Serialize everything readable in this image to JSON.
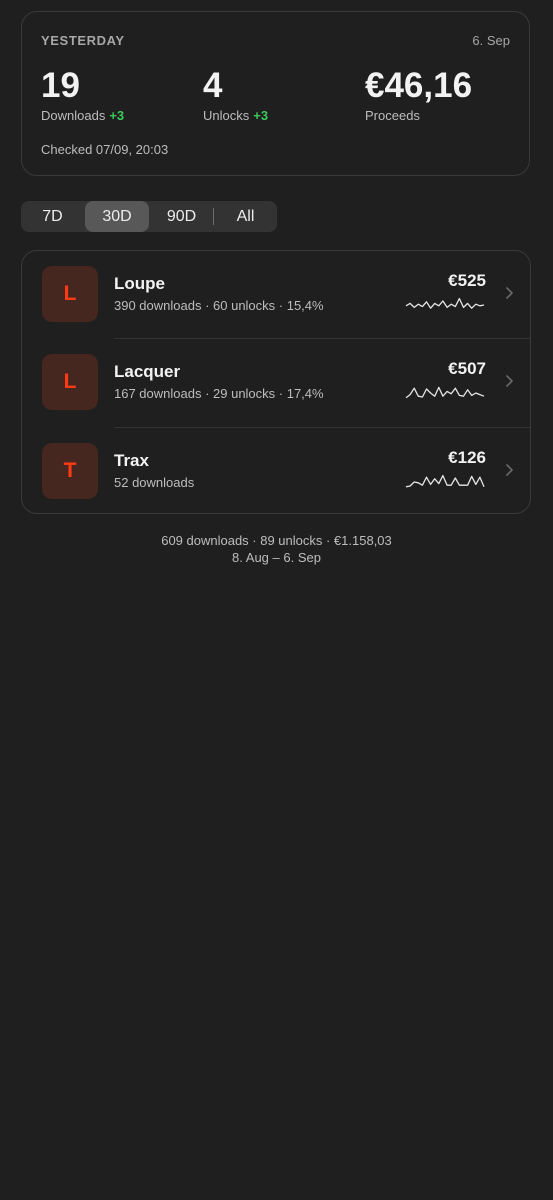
{
  "summary": {
    "period": "YESTERDAY",
    "date": "6. Sep",
    "downloads": {
      "value": "19",
      "label": "Downloads",
      "delta": "+3"
    },
    "unlocks": {
      "value": "4",
      "label": "Unlocks",
      "delta": "+3"
    },
    "proceeds": {
      "value": "€46,16",
      "label": "Proceeds"
    },
    "checked": "Checked 07/09, 20:03",
    "delta_color": "#3dc95a"
  },
  "range_tabs": {
    "items": [
      "7D",
      "30D",
      "90D",
      "All"
    ],
    "selected": "30D"
  },
  "apps": [
    {
      "initial": "L",
      "name": "Loupe",
      "stats": "390 downloads · 60 unlocks · 15,4%",
      "amount": "€525",
      "trend": [
        0.45,
        0.6,
        0.35,
        0.55,
        0.4,
        0.7,
        0.3,
        0.6,
        0.45,
        0.75,
        0.35,
        0.55,
        0.4,
        0.9,
        0.35,
        0.6,
        0.3,
        0.55,
        0.45,
        0.5
      ]
    },
    {
      "initial": "L",
      "name": "Lacquer",
      "stats": "167 downloads · 29 unlocks · 17,4%",
      "amount": "€507",
      "trend": [
        0.2,
        0.4,
        0.8,
        0.3,
        0.25,
        0.75,
        0.5,
        0.3,
        0.85,
        0.3,
        0.6,
        0.45,
        0.8,
        0.35,
        0.3,
        0.7,
        0.35,
        0.5,
        0.4,
        0.3
      ]
    },
    {
      "initial": "T",
      "name": "Trax",
      "stats": "52 downloads",
      "amount": "€126",
      "trend": [
        0.2,
        0.25,
        0.5,
        0.45,
        0.3,
        0.8,
        0.35,
        0.7,
        0.4,
        0.9,
        0.3,
        0.3,
        0.75,
        0.3,
        0.3,
        0.3,
        0.85,
        0.35,
        0.8,
        0.2
      ]
    }
  ],
  "footer": {
    "totals": "609 downloads · 89 unlocks · €1.158,03",
    "range": "8. Aug – 6. Sep"
  },
  "colors": {
    "accent": "#ff3a14",
    "icon_bg": "#45271f",
    "background": "#1f1f1f"
  }
}
